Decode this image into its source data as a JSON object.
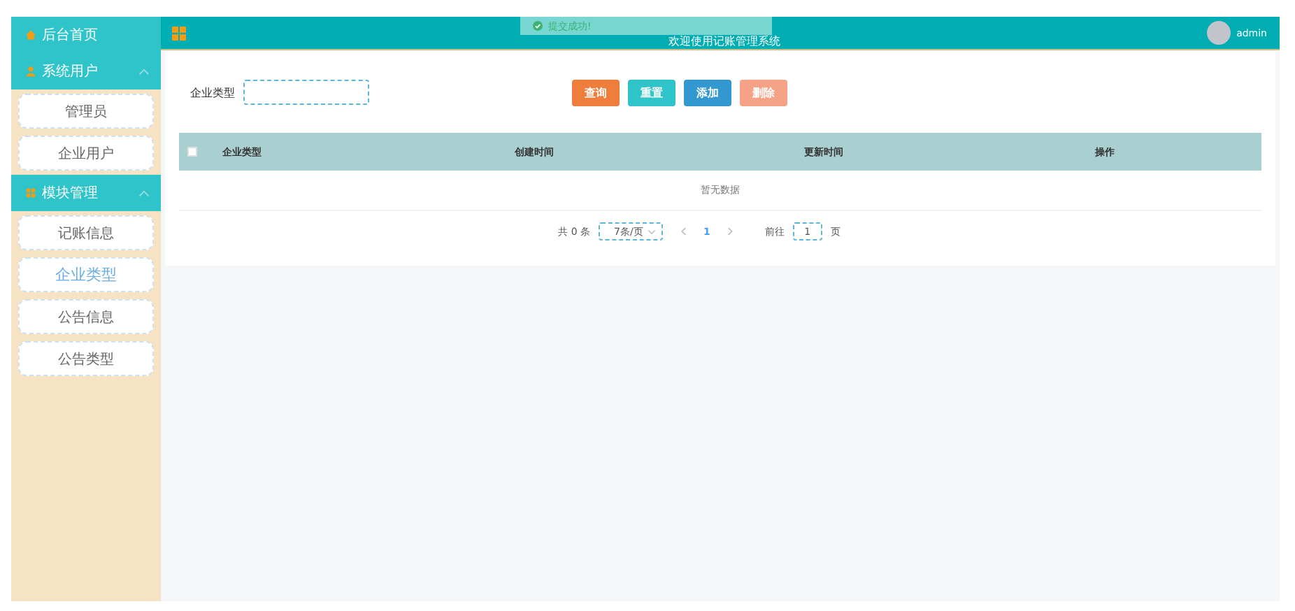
{
  "header": {
    "title": "欢迎使用记账管理系统",
    "user": "admin"
  },
  "toast": {
    "message": "提交成功!"
  },
  "sidebar": [
    {
      "label": "后台首页",
      "kind": "link"
    },
    {
      "label": "系统用户",
      "kind": "group",
      "expanded": true,
      "children": [
        {
          "label": "管理员",
          "selected": false
        },
        {
          "label": "企业用户",
          "selected": false
        }
      ]
    },
    {
      "label": "模块管理",
      "kind": "group",
      "expanded": true,
      "children": [
        {
          "label": "记账信息",
          "selected": false
        },
        {
          "label": "企业类型",
          "selected": true
        },
        {
          "label": "公告信息",
          "selected": false
        },
        {
          "label": "公告类型",
          "selected": false
        }
      ]
    }
  ],
  "filter": {
    "label": "企业类型"
  },
  "buttons": [
    {
      "label": "查询",
      "color": "#ef7d3c"
    },
    {
      "label": "重置",
      "color": "#2ec4c9"
    },
    {
      "label": "添加",
      "color": "#3298cf"
    },
    {
      "label": "删除",
      "color": "#f6a287"
    }
  ],
  "table": {
    "select_all_checked": false,
    "columns": [
      "企业类型",
      "创建时间",
      "更新时间",
      "操作"
    ],
    "empty": "暂无数据"
  },
  "pagination": {
    "total": "共 0 条",
    "page_size": "7条/页",
    "page": "1",
    "goto_label": "前往",
    "goto_value": "1",
    "goto_suffix": "页"
  }
}
